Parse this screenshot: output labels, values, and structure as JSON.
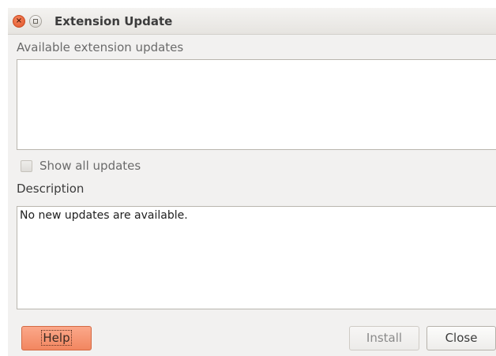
{
  "window": {
    "title": "Extension Update",
    "close_glyph": "×"
  },
  "updates": {
    "label": "Available extension updates",
    "items": []
  },
  "show_all": {
    "label": "Show all updates",
    "checked": false
  },
  "description": {
    "label": "Description",
    "text": "No new updates are available."
  },
  "buttons": {
    "help": "Help",
    "install": "Install",
    "close": "Close"
  },
  "colors": {
    "accent": "#f28660",
    "window_bg": "#f2f1f0"
  }
}
